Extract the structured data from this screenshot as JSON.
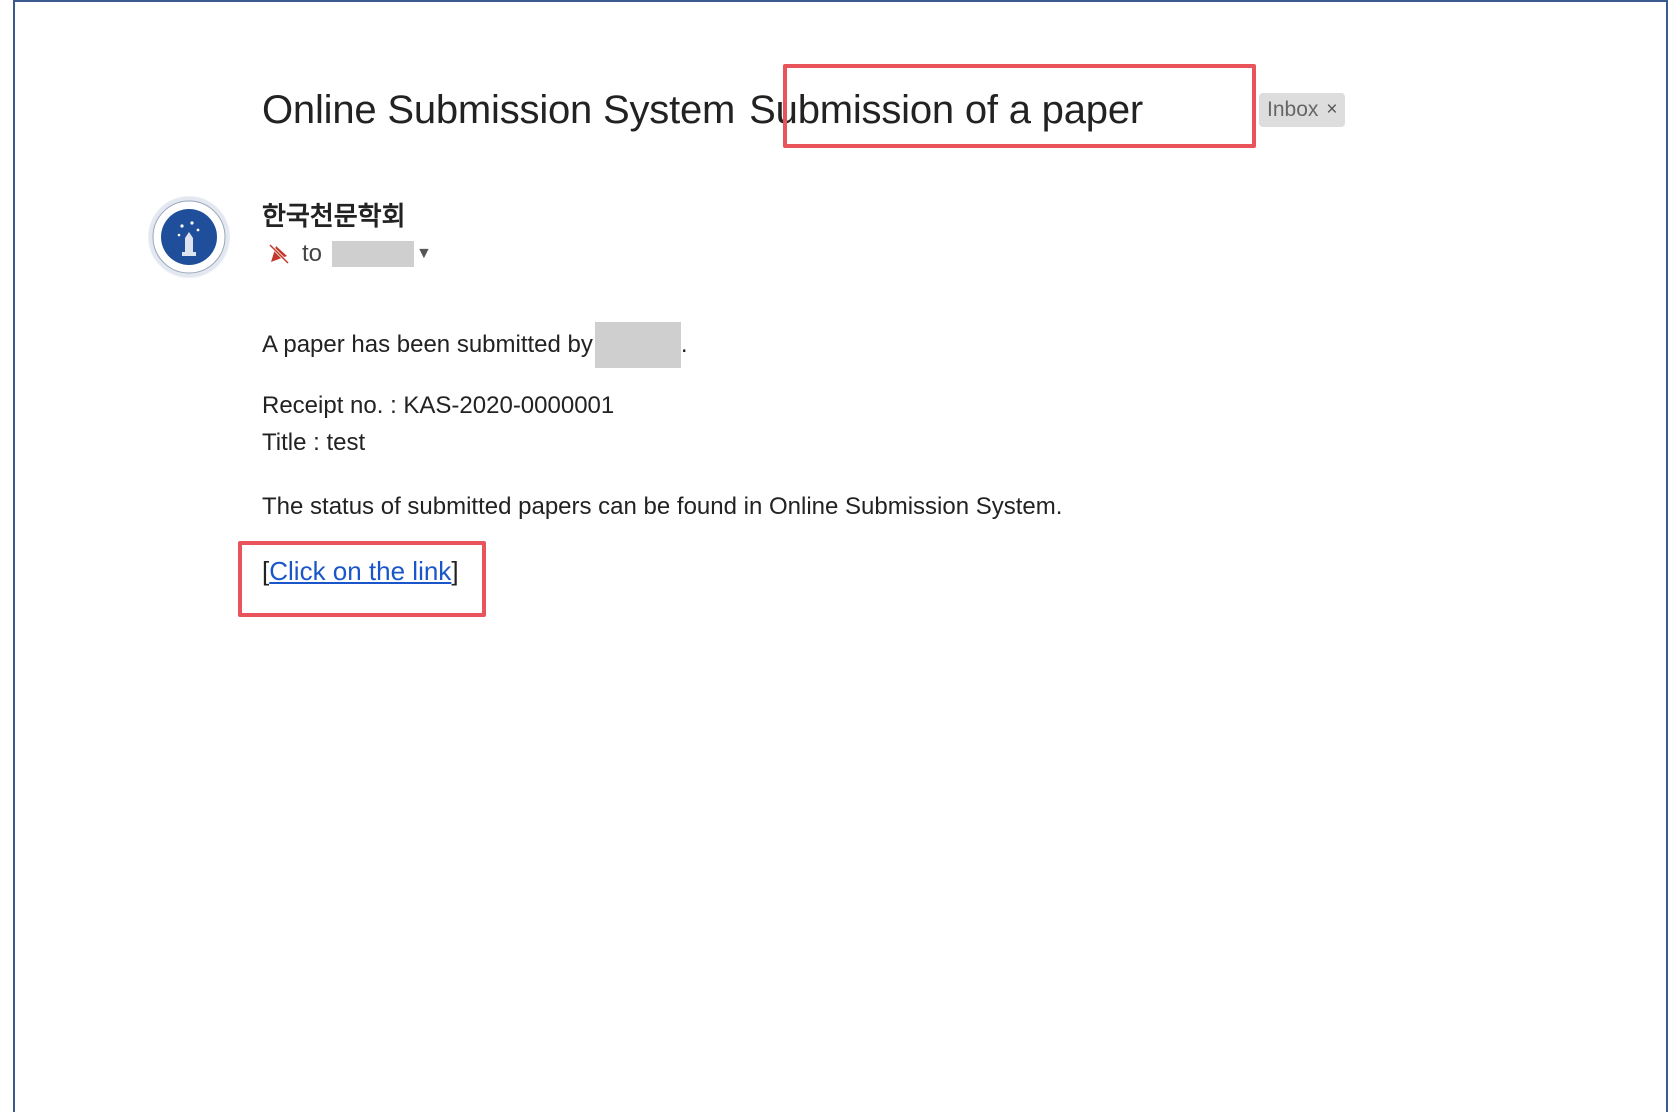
{
  "email": {
    "subject_prefix": "Online Submission System",
    "subject_main": "Submission of a paper",
    "label_chip": "Inbox",
    "label_chip_close": "×",
    "sender_name": "한국천문학회",
    "to_label": "to",
    "body": {
      "line1": "A paper has been submitted by",
      "line1_end": ".",
      "receipt": "Receipt no. : KAS-2020-0000001",
      "title": "Title : test",
      "status": "The status of submitted papers can be found in Online Submission System.",
      "link_open": "[",
      "link_text": "Click on the link",
      "link_close": "]"
    }
  },
  "colors": {
    "highlight": "#e8545a",
    "link": "#1a56c9",
    "frame": "#3b5b8c",
    "avatar_seal": "#1f4e9a"
  },
  "icons": {
    "avatar": "society-seal-icon",
    "recipient": "muted-recipient-icon",
    "dropdown": "chevron-down-icon"
  }
}
